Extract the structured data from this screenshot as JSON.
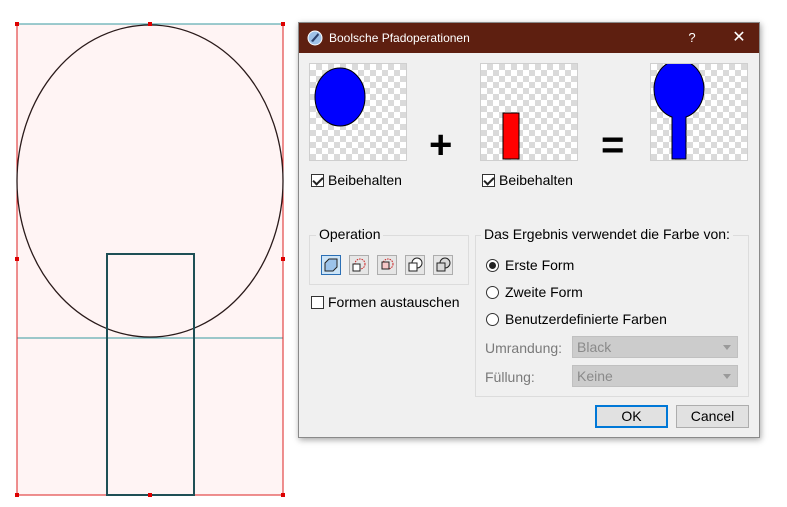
{
  "dialog": {
    "title": "Boolsche Pfadoperationen",
    "help_label": "?",
    "close_label": "✕",
    "plus_symbol": "+",
    "equals_symbol": "=",
    "keep_first_label": "Beibehalten",
    "keep_second_label": "Beibehalten",
    "keep_first_checked": true,
    "keep_second_checked": true,
    "operation_group_title": "Operation",
    "operation_icons": [
      "union-icon",
      "intersection-icon",
      "difference-icon",
      "xor-icon",
      "exclusion-icon"
    ],
    "swap_shapes_label": "Formen austauschen",
    "swap_shapes_checked": false,
    "color_group_title": "Das Ergebnis verwendet die Farbe von:",
    "radio_options": [
      "Erste Form",
      "Zweite Form",
      "Benutzerdefinierte Farben"
    ],
    "selected_radio": 0,
    "stroke_label": "Umrandung:",
    "stroke_value": "Black",
    "fill_label": "Füllung:",
    "fill_value": "Keine",
    "ok_label": "OK",
    "cancel_label": "Cancel"
  },
  "colors": {
    "titlebar": "#5e1f10",
    "shape_blue": "#0000ff",
    "shape_red": "#ff0000",
    "selection_red": "#dd0000",
    "canvas_fill": "#fff4f4",
    "bbox_teal": "#3a9aa0",
    "accent_blue": "#0078d7"
  }
}
